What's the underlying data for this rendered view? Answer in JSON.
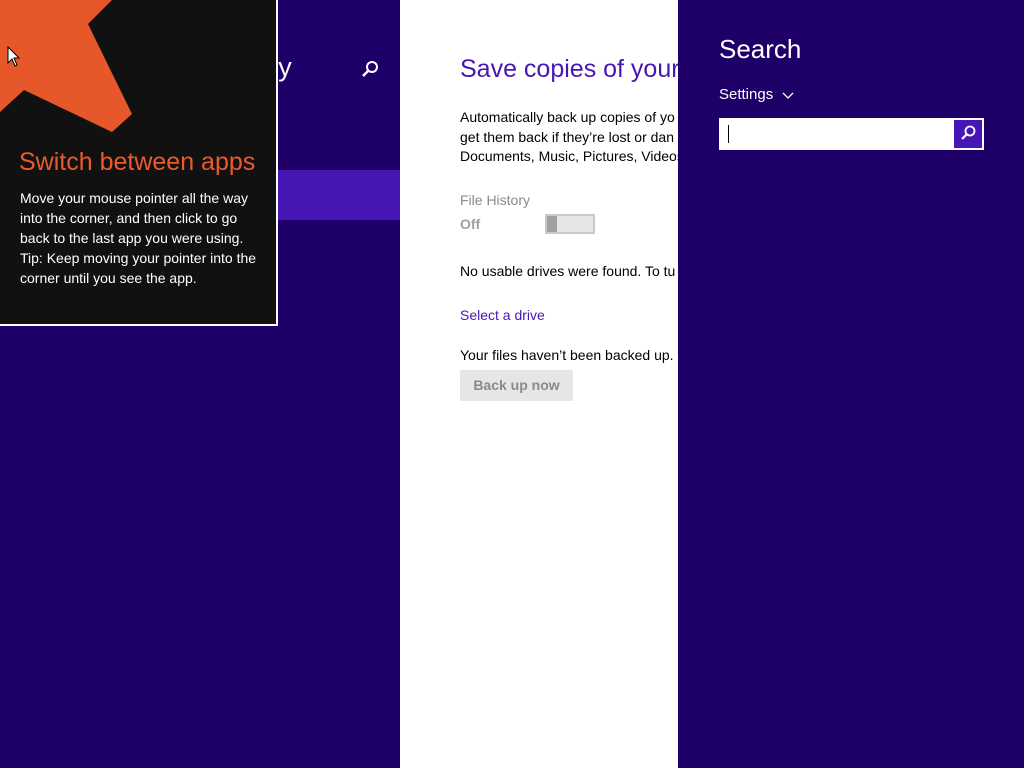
{
  "nav": {
    "title": "y",
    "search_icon": "search-icon"
  },
  "content": {
    "title": "Save copies of your",
    "description_lines": [
      "Automatically back up copies of yo",
      "get them back if they’re lost or dan",
      "Documents, Music, Pictures, Videos"
    ],
    "file_history_label": "File History",
    "file_history_state": "Off",
    "toggle_on": false,
    "no_drives_text": "No usable drives were found. To tu",
    "select_drive_link": "Select a drive",
    "not_backed_up_text": "Your files haven’t been backed up.",
    "backup_button": "Back up now"
  },
  "search_charm": {
    "title": "Search",
    "scope": "Settings",
    "scope_icon": "chevron-down-icon",
    "input_value": "",
    "go_icon": "search-icon"
  },
  "tip": {
    "title": "Switch between apps",
    "body_lines": [
      "Move your mouse pointer all the way into the corner, and then click to go back to the last app you were using.",
      "Tip: Keep moving your pointer into the corner until you see the app."
    ],
    "arrow_icon": "arrow-up-left-icon"
  },
  "colors": {
    "background": "#1f0068",
    "accent": "#4617b4",
    "tip_title": "#ec5a2b",
    "tip_arrow": "#e6572a",
    "tip_background": "#111111"
  }
}
